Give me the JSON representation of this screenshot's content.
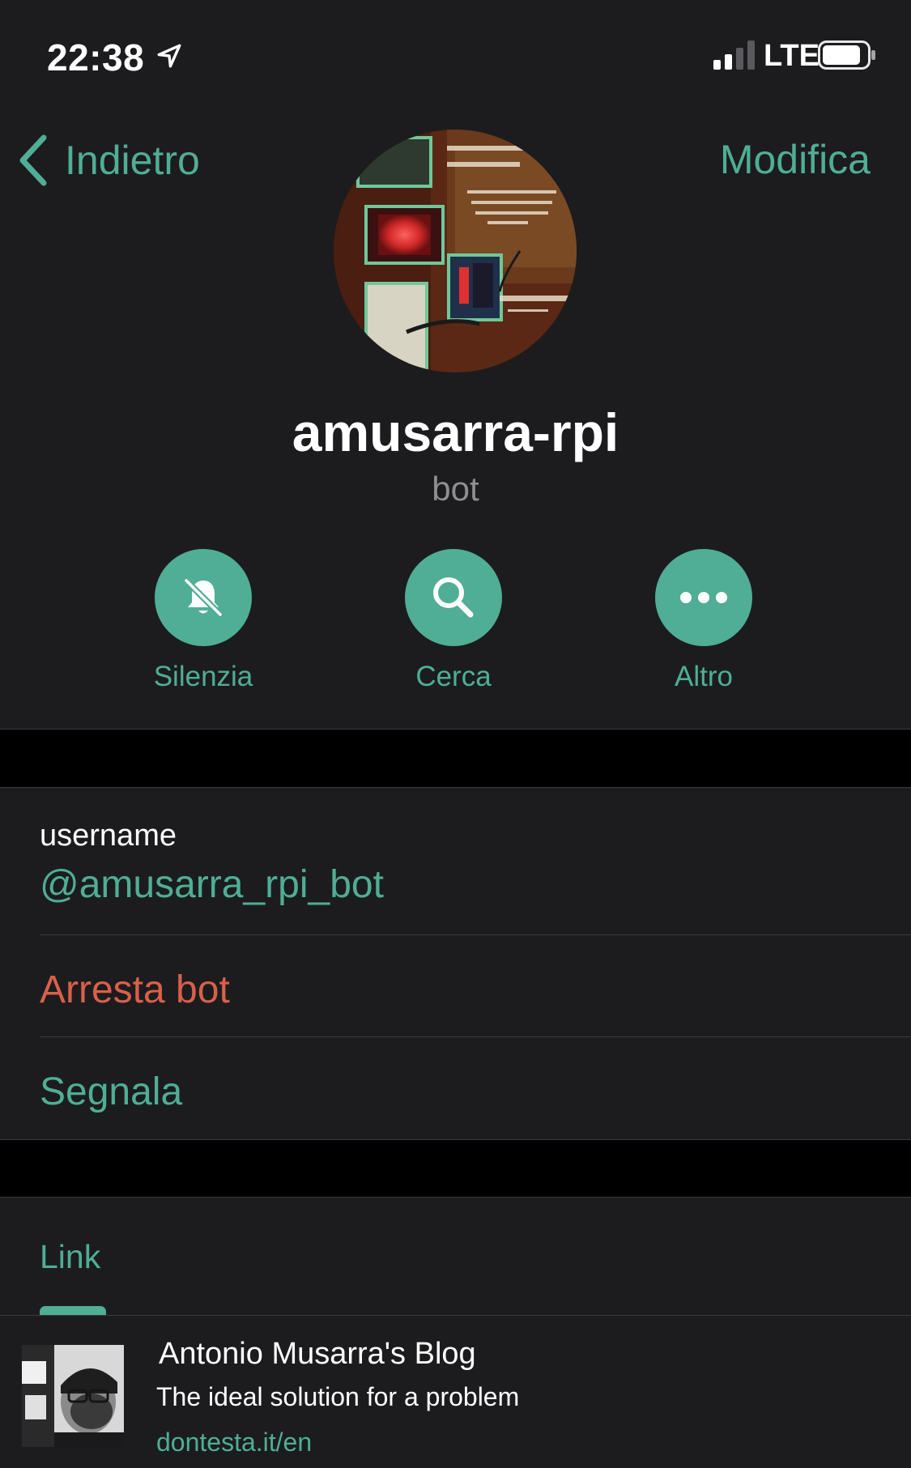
{
  "colors": {
    "accent": "#4fae95",
    "destructive": "#d9604a",
    "background": "#000000",
    "surface": "#1c1c1e",
    "secondary_text": "#8e8e93"
  },
  "status_bar": {
    "time": "22:38",
    "network": "LTE",
    "icons": [
      "location-arrow-icon",
      "signal-icon",
      "battery-icon"
    ]
  },
  "nav": {
    "back_label": "Indietro",
    "back_icon": "chevron-left-icon",
    "edit_label": "Modifica"
  },
  "profile": {
    "name": "amusarra-rpi",
    "subtitle": "bot",
    "avatar_icon": "bot-avatar-photo"
  },
  "actions": [
    {
      "label": "Silenzia",
      "icon": "bell-slash-icon"
    },
    {
      "label": "Cerca",
      "icon": "search-icon"
    },
    {
      "label": "Altro",
      "icon": "ellipsis-icon"
    }
  ],
  "info": {
    "username_label": "username",
    "username_value": "@amusarra_rpi_bot",
    "stop_bot_label": "Arresta bot",
    "report_label": "Segnala"
  },
  "links": {
    "tab_label": "Link",
    "items": [
      {
        "title": "Antonio Musarra's Blog",
        "description": "The ideal solution for a problem",
        "url": "dontesta.it/en",
        "thumb_icon": "blog-thumbnail"
      }
    ]
  }
}
